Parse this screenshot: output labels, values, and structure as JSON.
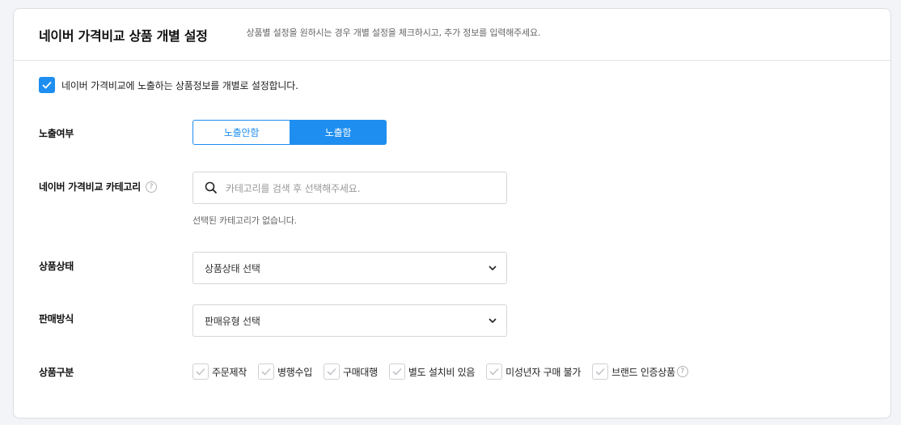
{
  "header": {
    "title": "네이버 가격비교 상품 개별 설정",
    "description": "상품별 설정을 원하시는 경우 개별 설정을 체크하시고, 추가 정보를 입력해주세요."
  },
  "master_checkbox": {
    "label": "네이버 가격비교에 노출하는 상품정보를 개별로 설정합니다.",
    "checked": true
  },
  "exposure": {
    "label": "노출여부",
    "options": [
      "노출안함",
      "노출함"
    ],
    "selected": "노출함"
  },
  "category": {
    "label": "네이버 가격비교 카테고리",
    "help_icon": "question-circle-icon",
    "search_placeholder": "카테고리를 검색 후 선택해주세요.",
    "empty_note": "선택된 카테고리가 없습니다."
  },
  "product_status": {
    "label": "상품상태",
    "selected": "상품상태 선택"
  },
  "sales_method": {
    "label": "판매방식",
    "selected": "판매유형 선택"
  },
  "product_type": {
    "label": "상품구분",
    "options": [
      {
        "label": "주문제작",
        "checked": false
      },
      {
        "label": "병행수입",
        "checked": false
      },
      {
        "label": "구매대행",
        "checked": false
      },
      {
        "label": "별도 설치비 있음",
        "checked": false
      },
      {
        "label": "미성년자 구매 불가",
        "checked": false
      },
      {
        "label": "브랜드 인증상품",
        "checked": false,
        "help_icon": "question-circle-icon"
      }
    ]
  },
  "colors": {
    "accent": "#1e8ef0",
    "background": "#f3f4f7",
    "border": "#d5d6da"
  }
}
